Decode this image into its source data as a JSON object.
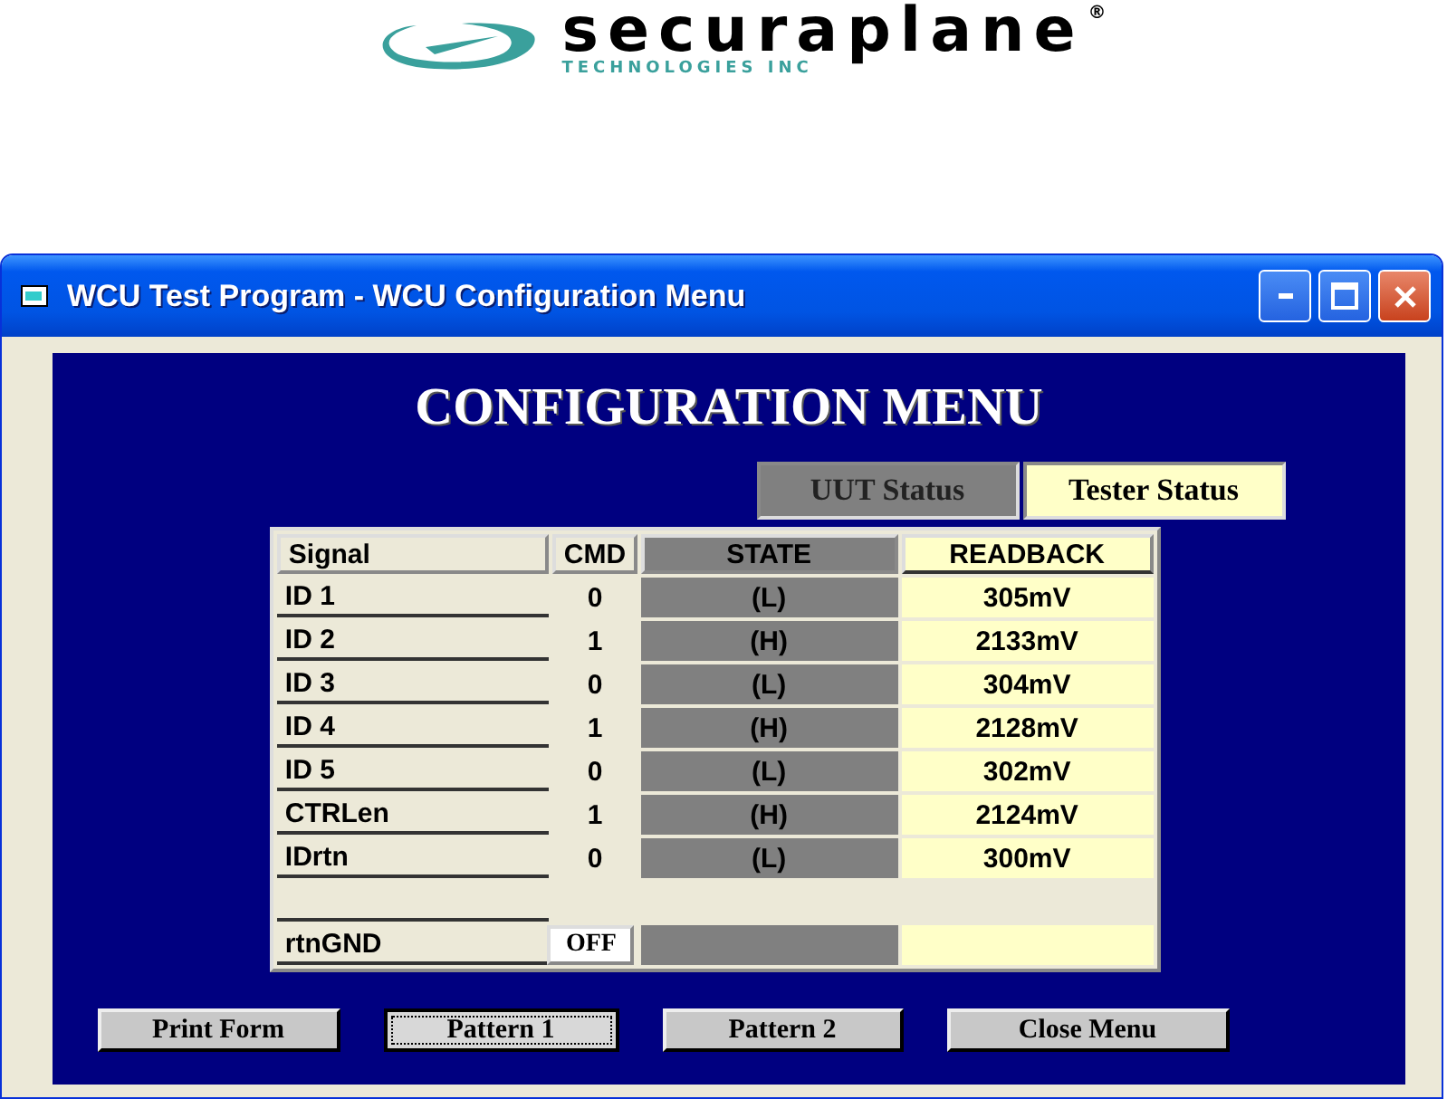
{
  "logo": {
    "brand": "securaplane",
    "mark": "®",
    "subtitle": "TECHNOLOGIES INC"
  },
  "window": {
    "title": "WCU Test Program - WCU Configuration Menu"
  },
  "heading": "CONFIGURATION MENU",
  "status_tabs": [
    {
      "label": "UUT Status",
      "kind": "uut"
    },
    {
      "label": "Tester Status",
      "kind": "tester"
    }
  ],
  "table": {
    "columns": [
      "Signal",
      "CMD",
      "STATE",
      "READBACK"
    ],
    "rows": [
      {
        "kind": "signal",
        "signal": "ID 1",
        "cmd": "0",
        "state": "(L)",
        "readback": "305mV"
      },
      {
        "kind": "signal",
        "signal": "ID 2",
        "cmd": "1",
        "state": "(H)",
        "readback": "2133mV"
      },
      {
        "kind": "signal",
        "signal": "ID 3",
        "cmd": "0",
        "state": "(L)",
        "readback": "304mV"
      },
      {
        "kind": "signal",
        "signal": "ID 4",
        "cmd": "1",
        "state": "(H)",
        "readback": "2128mV"
      },
      {
        "kind": "signal",
        "signal": "ID 5",
        "cmd": "0",
        "state": "(L)",
        "readback": "302mV"
      },
      {
        "kind": "signal",
        "signal": "CTRLen",
        "cmd": "1",
        "state": "(H)",
        "readback": "2124mV"
      },
      {
        "kind": "signal",
        "signal": "IDrtn",
        "cmd": "0",
        "state": "(L)",
        "readback": "300mV"
      },
      {
        "kind": "blank"
      },
      {
        "kind": "toggle",
        "signal": "rtnGND",
        "cmd": "OFF"
      }
    ]
  },
  "buttons": [
    {
      "label": "Print Form",
      "focused": false
    },
    {
      "label": "Pattern 1",
      "focused": true
    },
    {
      "label": "Pattern 2",
      "focused": false
    },
    {
      "label": "Close Menu",
      "focused": false
    }
  ]
}
